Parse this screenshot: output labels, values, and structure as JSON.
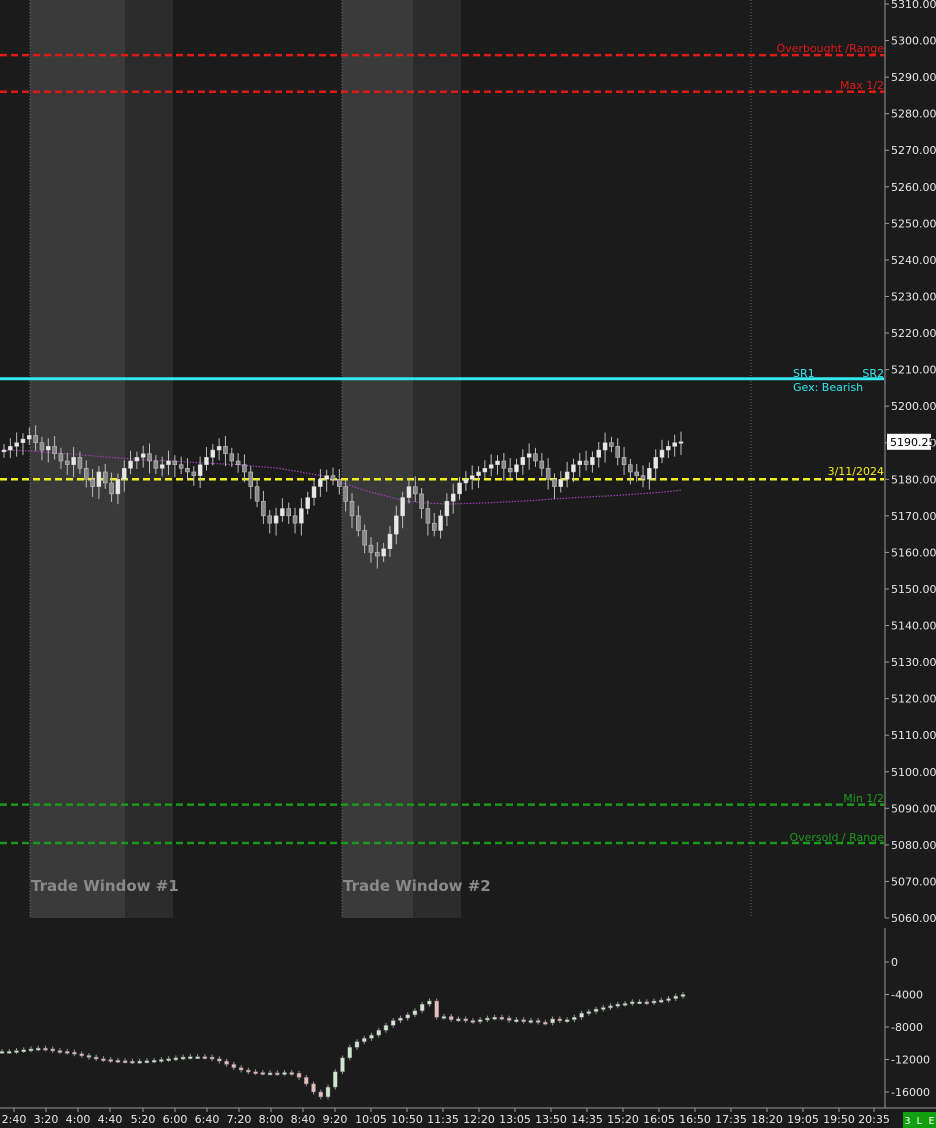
{
  "chart_data": [
    {
      "type": "candlestick",
      "ylim": [
        5060,
        5310
      ],
      "y_ticks": [
        5310,
        5300,
        5290,
        5280,
        5270,
        5260,
        5250,
        5240,
        5230,
        5220,
        5210,
        5200,
        5190,
        5180,
        5170,
        5160,
        5150,
        5140,
        5130,
        5120,
        5110,
        5100,
        5090,
        5080,
        5070,
        5060
      ],
      "y_tick_labels": [
        "5310.00",
        "5300.00",
        "5290.00",
        "5280.00",
        "5270.00",
        "5260.00",
        "5250.00",
        "5240.00",
        "5230.00",
        "5220.00",
        "5210.00",
        "5200.00",
        "5190.00",
        "5180.00",
        "5170.00",
        "5160.00",
        "5150.00",
        "5140.00",
        "5130.00",
        "5120.00",
        "5110.00",
        "5100.00",
        "5090.00",
        "5080.00",
        "5070.00",
        "5060.00"
      ],
      "last_price": "5190.25",
      "levels": [
        {
          "label": "Overbought /Range",
          "value": 5296,
          "color": "#e01818",
          "style": "dashed"
        },
        {
          "label": "Max 1/2",
          "value": 5286,
          "color": "#e01818",
          "style": "dashed"
        },
        {
          "label": "SR1",
          "value": 5207.5,
          "color": "#35e8f0",
          "style": "solid"
        },
        {
          "label": "SR2",
          "value": 5207.5,
          "color": "#35e8f0",
          "style": "solid"
        },
        {
          "label": "Gex: Bearish",
          "value": 5207.5,
          "color": "#35e8f0",
          "style": "note"
        },
        {
          "label": "3/11/2024",
          "value": 5180,
          "color": "#f2ee1e",
          "style": "dashed"
        },
        {
          "label": "Min 1/2",
          "value": 5091,
          "color": "#1a9a1a",
          "style": "dashed"
        },
        {
          "label": "Oversold / Range",
          "value": 5080.5,
          "color": "#1a9a1a",
          "style": "dashed"
        }
      ],
      "windows": [
        {
          "label": "Trade Window #1"
        },
        {
          "label": "Trade Window #2"
        }
      ],
      "price_path": [
        5188,
        5189,
        5190,
        5191,
        5192,
        5190,
        5188,
        5189,
        5187,
        5185,
        5184,
        5186,
        5183,
        5180,
        5178,
        5182,
        5179,
        5176,
        5180,
        5183,
        5185,
        5186,
        5187,
        5185,
        5183,
        5184,
        5185,
        5184,
        5183,
        5182,
        5181,
        5184,
        5186,
        5188,
        5189,
        5187,
        5185,
        5184,
        5182,
        5178,
        5174,
        5170,
        5168,
        5170,
        5172,
        5170,
        5168,
        5172,
        5175,
        5178,
        5180,
        5181,
        5180,
        5178,
        5174,
        5170,
        5166,
        5162,
        5160,
        5159,
        5161,
        5165,
        5170,
        5175,
        5178,
        5176,
        5172,
        5168,
        5166,
        5170,
        5174,
        5176,
        5179,
        5180,
        5181,
        5182,
        5183,
        5184,
        5185,
        5183,
        5182,
        5184,
        5186,
        5187,
        5185,
        5183,
        5180,
        5178,
        5180,
        5182,
        5184,
        5185,
        5184,
        5186,
        5188,
        5190,
        5189,
        5186,
        5184,
        5182,
        5181,
        5180,
        5183,
        5186,
        5188,
        5189,
        5190,
        5190.25
      ],
      "vwap_path": [
        5188,
        5187.8,
        5187.4,
        5187,
        5186.5,
        5186,
        5185.6,
        5185.2,
        5185,
        5184.6,
        5184.3,
        5184,
        5183.5,
        5183,
        5182,
        5181,
        5179,
        5177,
        5175.5,
        5174,
        5173.5,
        5173.2,
        5173.4,
        5173.6,
        5173.9,
        5174.2,
        5174.6,
        5175,
        5175.3,
        5175.6,
        5176,
        5176.4,
        5177
      ],
      "x_tick_labels": [
        "2:40",
        "3:20",
        "4:00",
        "4:40",
        "5:20",
        "6:00",
        "6:40",
        "7:20",
        "8:00",
        "8:40",
        "9:20",
        "10:05",
        "10:50",
        "11:35",
        "12:20",
        "13:05",
        "13:50",
        "14:35",
        "15:20",
        "16:05",
        "16:50",
        "17:35",
        "18:20",
        "19:05",
        "19:50",
        "20:35"
      ]
    },
    {
      "type": "candlestick",
      "ylim": [
        -17500,
        500
      ],
      "y_ticks": [
        0,
        -4000,
        -8000,
        -12000,
        -16000
      ],
      "y_tick_labels": [
        "0",
        "-4000",
        "-8000",
        "-12000",
        "-16000"
      ],
      "path": [
        -11000,
        -11000,
        -10900,
        -10800,
        -10700,
        -10600,
        -10700,
        -10900,
        -11000,
        -11100,
        -11300,
        -11500,
        -11700,
        -11900,
        -12000,
        -12100,
        -12150,
        -12200,
        -12250,
        -12200,
        -12150,
        -12100,
        -12000,
        -11900,
        -11800,
        -11700,
        -11650,
        -11650,
        -11700,
        -11900,
        -12200,
        -12600,
        -13000,
        -13300,
        -13500,
        -13600,
        -13650,
        -13650,
        -13700,
        -13600,
        -13700,
        -14200,
        -15000,
        -16000,
        -16600,
        -15400,
        -13500,
        -11800,
        -10500,
        -9800,
        -9400,
        -9000,
        -8400,
        -7800,
        -7200,
        -6900,
        -6500,
        -6000,
        -5200,
        -4800,
        -6800,
        -6700,
        -7100,
        -7000,
        -7200,
        -7300,
        -7100,
        -6900,
        -6800,
        -6900,
        -7200,
        -7100,
        -7300,
        -7200,
        -7400,
        -7500,
        -7000,
        -7200,
        -7100,
        -6800,
        -6300,
        -6100,
        -5800,
        -5600,
        -5400,
        -5200,
        -5100,
        -4900,
        -4900,
        -5000,
        -4800,
        -4700,
        -4500,
        -4200,
        -4000
      ]
    }
  ],
  "status_badge": "3 L E",
  "colors": {
    "background": "#1b1b1b",
    "window_light": "#3a3a3a",
    "window_dark": "#2b2b2b",
    "candle_up": "#e8e8e8",
    "candle_down": "#8a8a8a",
    "vwap": "#a63cc0",
    "badge_bg": "#10a010"
  }
}
